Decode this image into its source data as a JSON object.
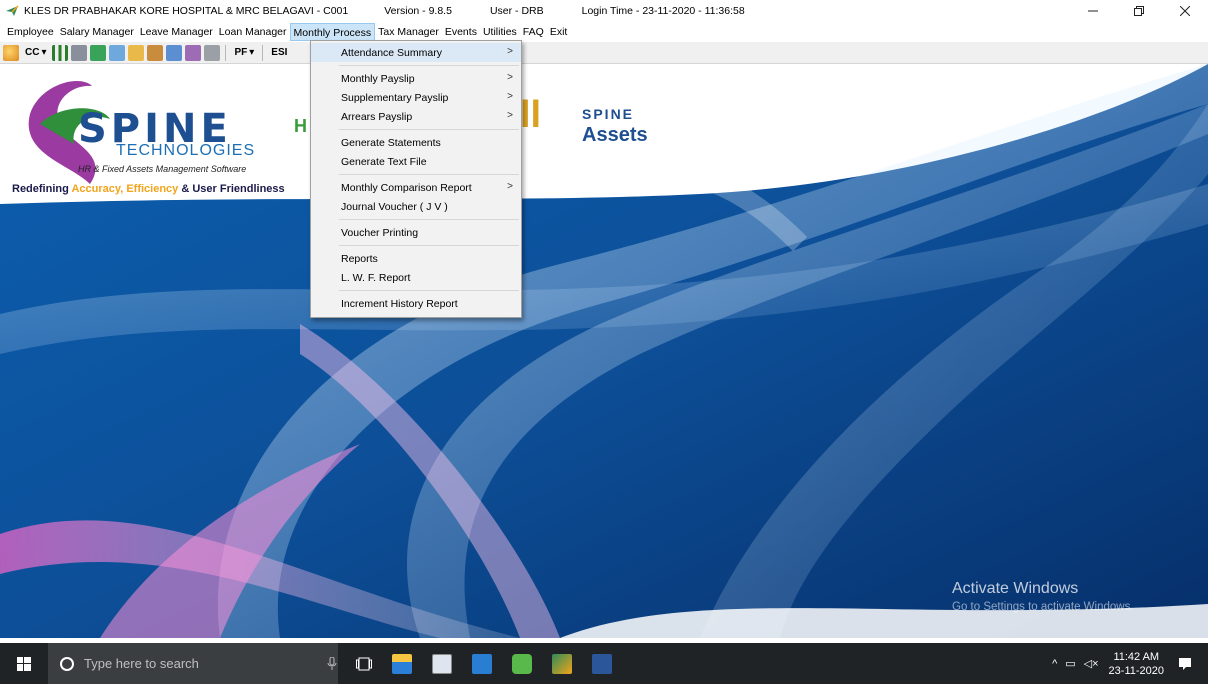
{
  "titlebar": {
    "title": "KLES DR PRABHAKAR KORE HOSPITAL & MRC BELAGAVI  -  C001",
    "version": "Version - 9.8.5",
    "user": "User - DRB",
    "login": "Login Time - 23-11-2020 - 11:36:58",
    "minimize_icon": "minimize-icon",
    "restore_icon": "restore-icon",
    "close_icon": "close-icon"
  },
  "menubar": {
    "items": [
      "Employee",
      "Salary Manager",
      "Leave Manager",
      "Loan Manager",
      "Monthly Process",
      "Tax Manager",
      "Events",
      "Utilities",
      "FAQ",
      "Exit"
    ],
    "active": "Monthly Process"
  },
  "toolbar": {
    "cc_label": "CC",
    "pf_label": "PF",
    "esi_label": "ESI"
  },
  "dropdown": {
    "items": [
      {
        "label": "Attendance Summary",
        "submenu": true
      },
      {
        "label": "Monthly Payslip",
        "submenu": true
      },
      {
        "label": "Supplementary Payslip",
        "submenu": true
      },
      {
        "label": "Arrears Payslip",
        "submenu": true
      },
      {
        "label": "Generate Statements",
        "submenu": false
      },
      {
        "label": "Generate Text File",
        "submenu": false
      },
      {
        "label": "Monthly Comparison Report",
        "submenu": true
      },
      {
        "label": "Journal Voucher ( J V )",
        "submenu": false
      },
      {
        "label": "Voucher Printing",
        "submenu": false
      },
      {
        "label": "Reports",
        "submenu": false
      },
      {
        "label": "L. W. F. Report",
        "submenu": false
      },
      {
        "label": "Increment History Report",
        "submenu": false
      }
    ],
    "arrow": ">"
  },
  "brand": {
    "spine": "SPINE",
    "technologies": "TECHNOLOGIES",
    "subtitle": "HR & Fixed Assets Management Software",
    "tagline_1": "Redefining ",
    "tagline_2": "Accuracy, Efficiency",
    "tagline_3": " & User Friendliness",
    "hr_short": "H",
    "pay_short": "ll",
    "assets_spine": "SPINE",
    "assets_label": "Assets"
  },
  "watermark": {
    "line1": "Activate Windows",
    "line2": "Go to Settings to activate Windows."
  },
  "taskbar": {
    "search_placeholder": "Type here to search",
    "time": "11:42 AM",
    "date": "23-11-2020"
  }
}
